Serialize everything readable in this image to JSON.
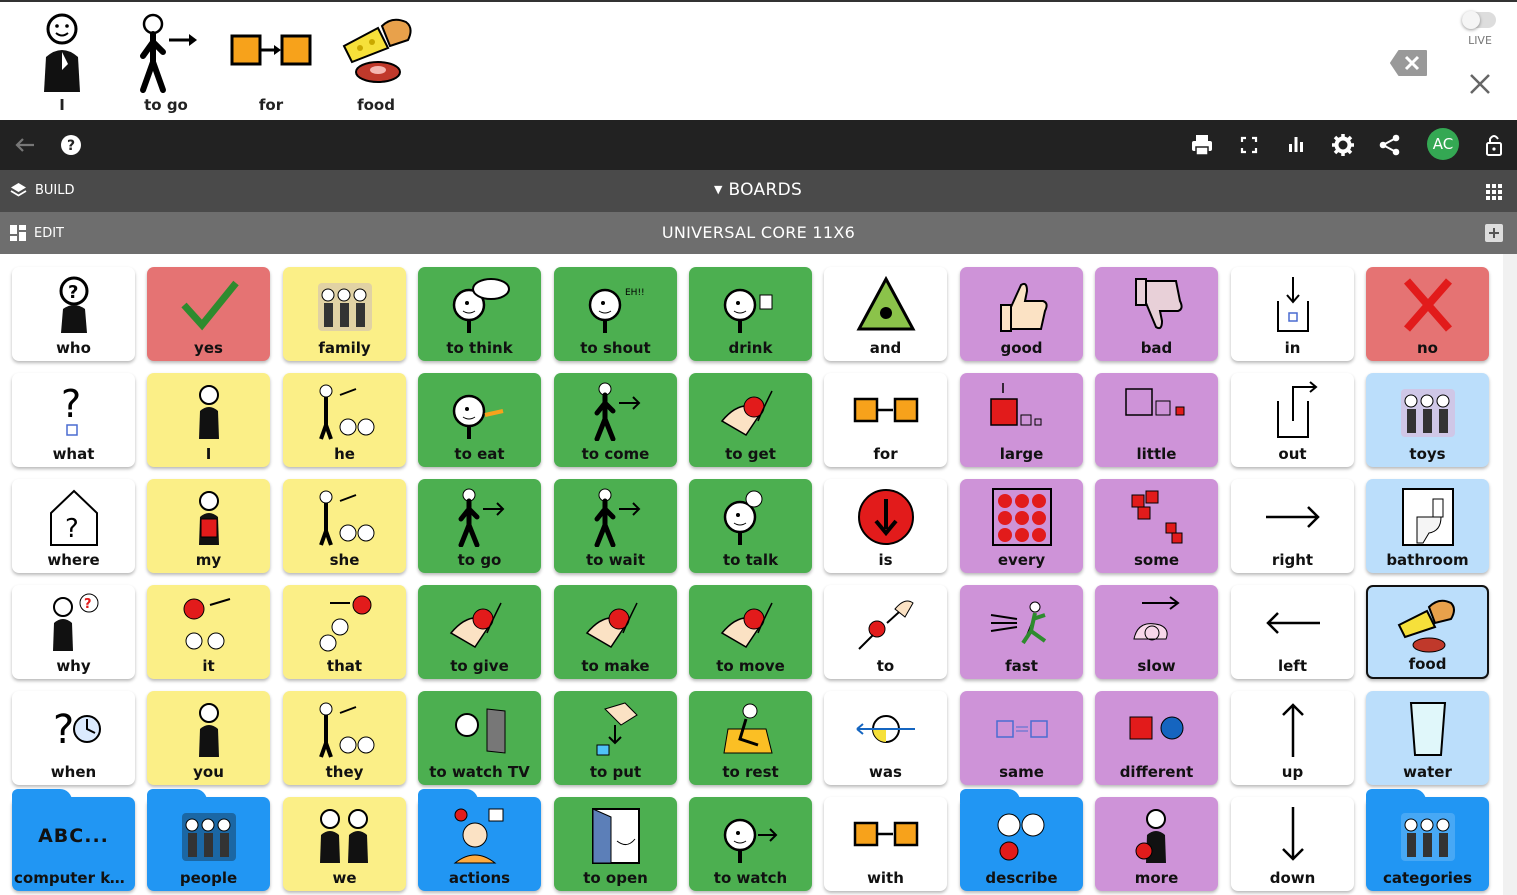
{
  "sentence_bar": {
    "items": [
      {
        "label": "I",
        "icon": "person-self-icon"
      },
      {
        "label": "to go",
        "icon": "person-walking-icon"
      },
      {
        "label": "for",
        "icon": "boxes-arrow-icon"
      },
      {
        "label": "food",
        "icon": "food-icon"
      }
    ],
    "live_label": "LIVE"
  },
  "toolbar": {
    "avatar_initials": "AC"
  },
  "build_bar": {
    "build_label": "BUILD",
    "boards_label": "BOARDS"
  },
  "edit_bar": {
    "edit_label": "EDIT",
    "board_title": "UNIVERSAL CORE 11X6"
  },
  "colors": {
    "white": "#ffffff",
    "red": "#e57373",
    "yellow": "#fbef87",
    "green": "#4caf50",
    "purple": "#ce93d8",
    "blue": "#bbdefb",
    "folder_blue": "#2196f3"
  },
  "tiles": [
    {
      "label": "who",
      "color": "white"
    },
    {
      "label": "yes",
      "color": "red"
    },
    {
      "label": "family",
      "color": "yellow"
    },
    {
      "label": "to think",
      "color": "green"
    },
    {
      "label": "to shout",
      "color": "green"
    },
    {
      "label": "drink",
      "color": "green"
    },
    {
      "label": "and",
      "color": "white"
    },
    {
      "label": "good",
      "color": "purple"
    },
    {
      "label": "bad",
      "color": "purple"
    },
    {
      "label": "in",
      "color": "white"
    },
    {
      "label": "no",
      "color": "red"
    },
    {
      "label": "what",
      "color": "white"
    },
    {
      "label": "I",
      "color": "yellow"
    },
    {
      "label": "he",
      "color": "yellow"
    },
    {
      "label": "to eat",
      "color": "green"
    },
    {
      "label": "to come",
      "color": "green"
    },
    {
      "label": "to get",
      "color": "green"
    },
    {
      "label": "for",
      "color": "white"
    },
    {
      "label": "large",
      "color": "purple"
    },
    {
      "label": "little",
      "color": "purple"
    },
    {
      "label": "out",
      "color": "white"
    },
    {
      "label": "toys",
      "color": "blue"
    },
    {
      "label": "where",
      "color": "white"
    },
    {
      "label": "my",
      "color": "yellow"
    },
    {
      "label": "she",
      "color": "yellow"
    },
    {
      "label": "to go",
      "color": "green"
    },
    {
      "label": "to wait",
      "color": "green"
    },
    {
      "label": "to talk",
      "color": "green"
    },
    {
      "label": "is",
      "color": "white"
    },
    {
      "label": "every",
      "color": "purple"
    },
    {
      "label": "some",
      "color": "purple"
    },
    {
      "label": "right",
      "color": "white"
    },
    {
      "label": "bathroom",
      "color": "blue"
    },
    {
      "label": "why",
      "color": "white"
    },
    {
      "label": "it",
      "color": "yellow"
    },
    {
      "label": "that",
      "color": "yellow"
    },
    {
      "label": "to give",
      "color": "green"
    },
    {
      "label": "to make",
      "color": "green"
    },
    {
      "label": "to move",
      "color": "green"
    },
    {
      "label": "to",
      "color": "white"
    },
    {
      "label": "fast",
      "color": "purple"
    },
    {
      "label": "slow",
      "color": "purple"
    },
    {
      "label": "left",
      "color": "white"
    },
    {
      "label": "food",
      "color": "blue",
      "selected": true
    },
    {
      "label": "when",
      "color": "white"
    },
    {
      "label": "you",
      "color": "yellow"
    },
    {
      "label": "they",
      "color": "yellow"
    },
    {
      "label": "to watch TV",
      "color": "green"
    },
    {
      "label": "to put",
      "color": "green"
    },
    {
      "label": "to rest",
      "color": "green"
    },
    {
      "label": "was",
      "color": "white"
    },
    {
      "label": "same",
      "color": "purple"
    },
    {
      "label": "different",
      "color": "purple"
    },
    {
      "label": "up",
      "color": "white"
    },
    {
      "label": "water",
      "color": "blue"
    },
    {
      "label": "computer ke...",
      "color": "folder_blue",
      "folder": true,
      "text_icon": "ABC..."
    },
    {
      "label": "people",
      "color": "folder_blue",
      "folder": true
    },
    {
      "label": "we",
      "color": "yellow"
    },
    {
      "label": "actions",
      "color": "folder_blue",
      "folder": true
    },
    {
      "label": "to open",
      "color": "green"
    },
    {
      "label": "to watch",
      "color": "green"
    },
    {
      "label": "with",
      "color": "white"
    },
    {
      "label": "describe",
      "color": "folder_blue",
      "folder": true
    },
    {
      "label": "more",
      "color": "purple"
    },
    {
      "label": "down",
      "color": "white"
    },
    {
      "label": "categories",
      "color": "folder_blue",
      "folder": true
    }
  ]
}
